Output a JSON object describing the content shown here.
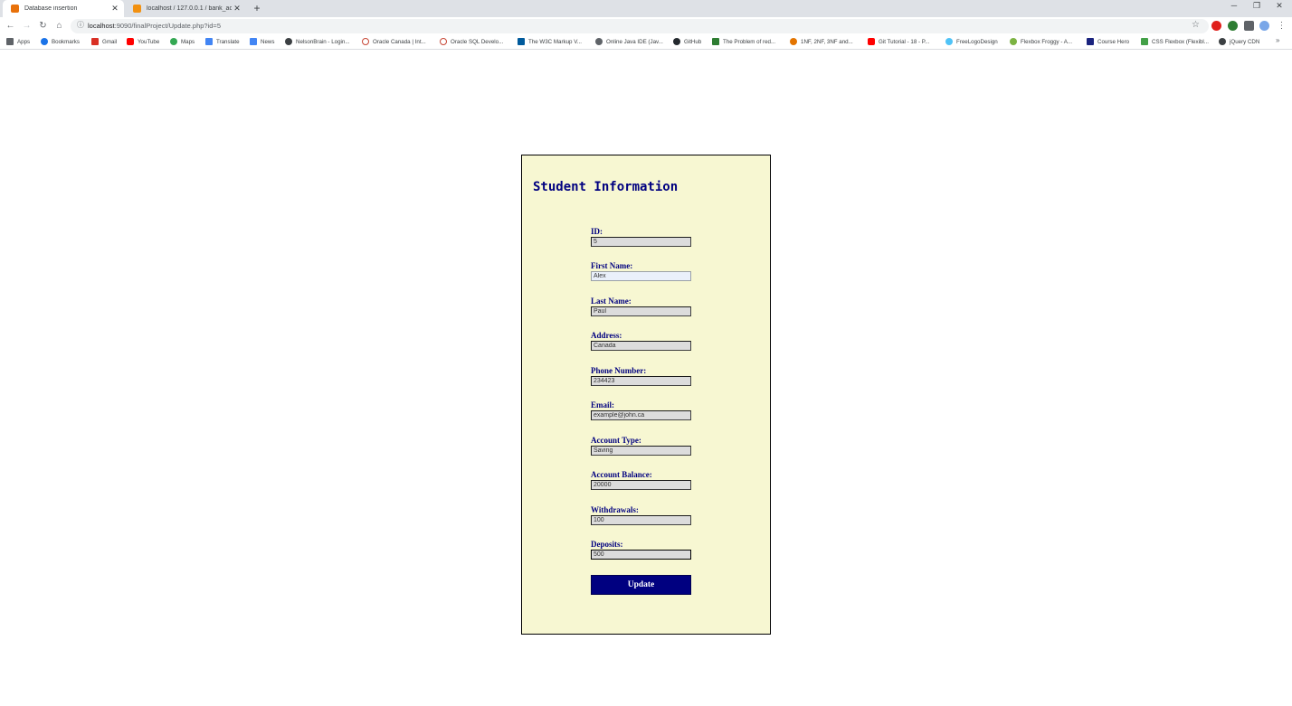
{
  "browser": {
    "tabs": [
      {
        "title": "Database insertion",
        "active": true
      },
      {
        "title": "localhost / 127.0.0.1 / bank_acco",
        "active": false
      }
    ],
    "url": {
      "host": "localhost",
      "rest": ":9090/finalProject/Update.php?id=5"
    },
    "bookmarks": [
      "Apps",
      "Bookmarks",
      "Gmail",
      "YouTube",
      "Maps",
      "Translate",
      "News",
      "NelsonBrain - Login...",
      "Oracle Canada | Int...",
      "Oracle SQL Develo...",
      "The W3C Markup V...",
      "Online Java IDE (Jav...",
      "GitHub",
      "The Problem of red...",
      "1NF, 2NF, 3NF and...",
      "Git Tutorial - 18 - P...",
      "FreeLogoDesign",
      "Flexbox Froggy - A...",
      "Course Hero",
      "CSS Flexbox (Flexibl...",
      "jQuery CDN"
    ]
  },
  "form": {
    "title": "Student Information",
    "fields": [
      {
        "label": "ID:",
        "value": "5"
      },
      {
        "label": "First Name:",
        "value": "Alex"
      },
      {
        "label": "Last Name:",
        "value": "Paul"
      },
      {
        "label": "Address:",
        "value": "Canada"
      },
      {
        "label": "Phone Number:",
        "value": "234423"
      },
      {
        "label": "Email:",
        "value": "example@john.ca"
      },
      {
        "label": "Account Type:",
        "value": "Saving"
      },
      {
        "label": "Account Balance:",
        "value": "20000"
      },
      {
        "label": "Withdrawals:",
        "value": "100"
      },
      {
        "label": "Deposits:",
        "value": "500"
      }
    ],
    "submit_label": "Update"
  },
  "colors": {
    "card_background": "#f7f7d2",
    "heading": "#000080",
    "button_background": "#000080"
  }
}
